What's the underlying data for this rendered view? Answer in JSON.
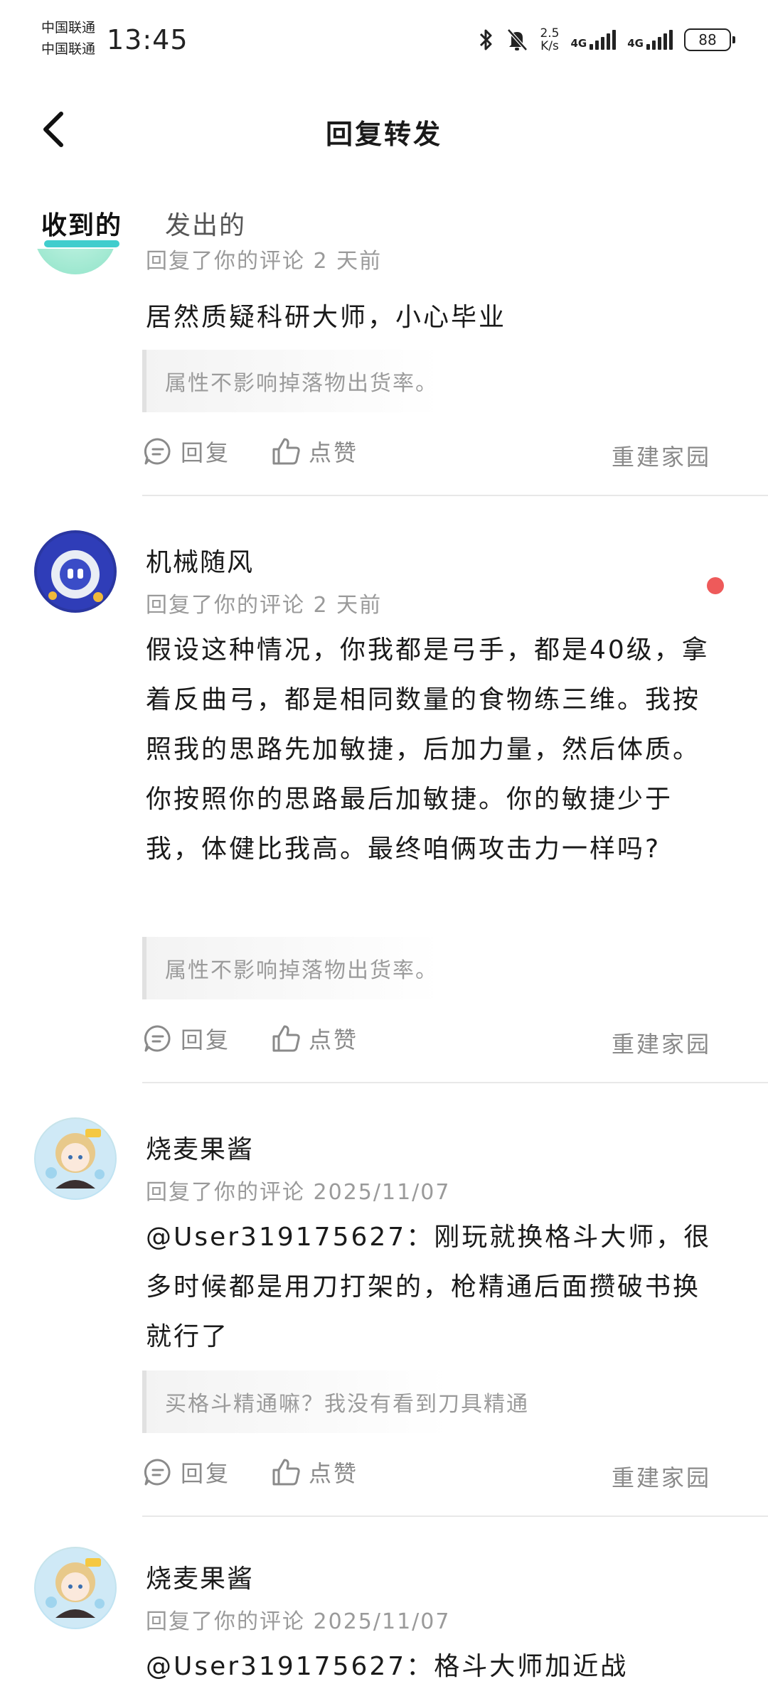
{
  "status_bar": {
    "carrier1": "中国联通",
    "carrier2": "中国联通",
    "time": "13:45",
    "speed_value": "2.5",
    "speed_unit": "K/s",
    "net1": "4G",
    "net2": "4G",
    "battery": "88"
  },
  "header": {
    "title": "回复转发",
    "back_icon": "chevron-left-icon"
  },
  "tabs": [
    {
      "label": "收到的",
      "active": true
    },
    {
      "label": "发出的",
      "active": false
    }
  ],
  "actions": {
    "reply": "回复",
    "like": "点赞",
    "reply_icon": "comment-icon",
    "like_icon": "thumbs-up-icon"
  },
  "accent_color": "#2bc8c8",
  "unread_color": "#ee5a5a",
  "items": [
    {
      "meta": "回复了你的评论 2 天前",
      "body": "居然质疑科研大师，小心毕业",
      "quote": "属性不影响掉落物出货率。",
      "source": "重建家园"
    },
    {
      "name": "机械随风",
      "meta": "回复了你的评论 2 天前",
      "body": "假设这种情况，你我都是弓手，都是40级，拿着反曲弓，都是相同数量的食物练三维。我按照我的思路先加敏捷，后加力量，然后体质。你按照你的思路最后加敏捷。你的敏捷少于我，体健比我高。最终咱俩攻击力一样吗?",
      "quote": "属性不影响掉落物出货率。",
      "source": "重建家园",
      "unread": true
    },
    {
      "name": "烧麦果酱",
      "meta": "回复了你的评论 2025/11/07",
      "body": "@User319175627：刚玩就换格斗大师，很多时候都是用刀打架的，枪精通后面攒破书换就行了",
      "quote": "买格斗精通嘛？我没有看到刀具精通",
      "source": "重建家园"
    },
    {
      "name": "烧麦果酱",
      "meta": "回复了你的评论 2025/11/07",
      "body": "@User319175627：格斗大师加近战"
    }
  ]
}
